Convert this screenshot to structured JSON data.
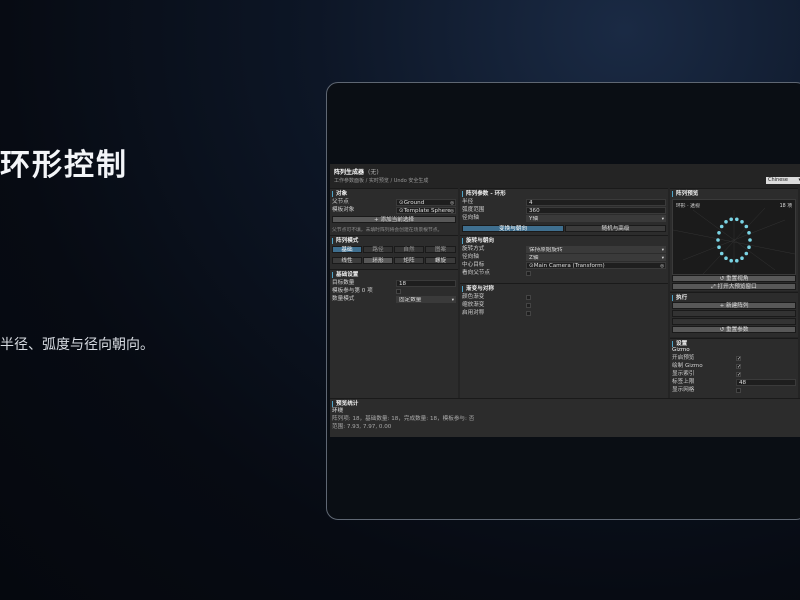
{
  "hero": {
    "title": "环形控制",
    "subtitle": "半径、弧度与径向朝向。"
  },
  "editor": {
    "title": "阵列生成器",
    "title_sub": "(无)",
    "hint": "工作参数面板 / 实时预览 / Undo 安全生成",
    "language": "Chinese",
    "object_panel": {
      "header": "对象",
      "parent_label": "父节点",
      "parent_value": "Ground",
      "template_label": "模板对象",
      "template_value": "Template Sphere",
      "add_button": "+ 添加当前选择",
      "note": "父节点可不填，未填时阵列将会创建在场景根节点。"
    },
    "mode_panel": {
      "header": "阵列模式",
      "tabs1": [
        "基础",
        "路径",
        "自然",
        "图案"
      ],
      "tabs2": [
        "线性",
        "环形",
        "矩阵",
        "螺旋"
      ]
    },
    "basic_panel": {
      "header": "基础设置",
      "count_label": "目标数量",
      "count_value": "18",
      "ref_label": "模板参与第 0 项",
      "mode_label": "数量模式",
      "mode_value": "固定数量"
    },
    "params_panel": {
      "header": "阵列参数 - 环形",
      "radius_label": "半径",
      "radius_value": "4",
      "arc_label": "弧度范围",
      "arc_value": "360",
      "axis_label": "径向轴",
      "axis_value": "Y轴",
      "tab_transform": "变换与朝向",
      "tab_random": "随机与高级"
    },
    "rotation_panel": {
      "header": "旋转与朝向",
      "mode_label": "旋转方式",
      "mode_value": "保持原始旋转",
      "axis_label": "径向轴",
      "axis_value": "Z轴",
      "target_label": "中心目标",
      "target_value": "Main Camera (Transform)",
      "face_label": "看向父节点"
    },
    "gradient_panel": {
      "header": "渐变与对称",
      "items": [
        "颜色渐变",
        "缩放渐变",
        "启用对称"
      ]
    },
    "preview_panel": {
      "header": "阵列预览",
      "view_label": "环形 · 透视",
      "count_label": "18 项",
      "reset_view": "↺ 重置视角",
      "open_big": "⤢ 打开大预览窗口"
    },
    "execute_panel": {
      "header": "执行",
      "new_array": "+ 新建阵列",
      "reset_params": "↺ 重置参数"
    },
    "settings_panel": {
      "header": "设置",
      "gizmo_label": "Gizmo",
      "items": [
        "开启预览",
        "绘制 Gizmo",
        "显示索引"
      ],
      "limit_label": "标签上限",
      "limit_value": "48",
      "extra_label": "显示网格"
    },
    "stats_panel": {
      "header": "预览统计",
      "mode": "环绕",
      "line1": "阵列项: 18，基础数量: 18，完成数量: 18，模板参与: 否",
      "line2": "范围: 7.93, 7.97, 0.00"
    }
  },
  "colors": {
    "accent": "#4fa3c7",
    "active_tab": "#3f6f8f",
    "preview_dot": "#7ad3e3"
  },
  "ring": {
    "count": 18
  }
}
